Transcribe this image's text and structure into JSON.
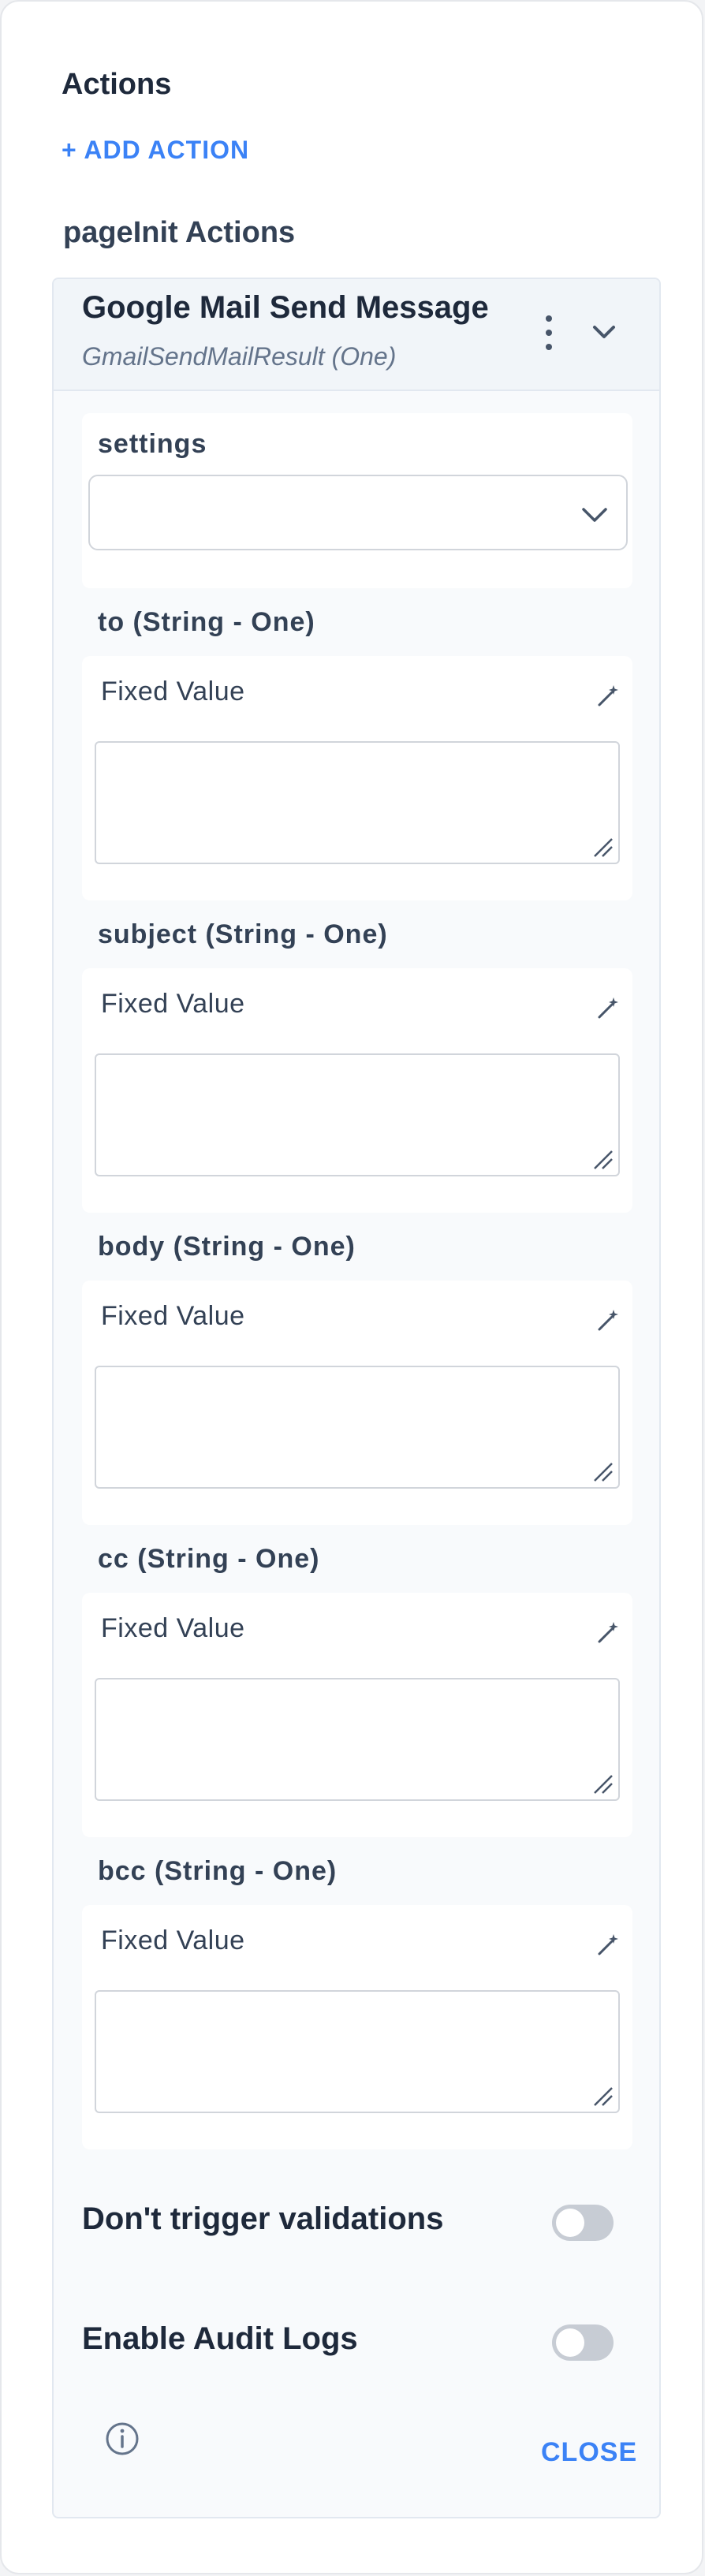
{
  "actions": {
    "title": "Actions",
    "add_action_label": "+ ADD ACTION",
    "page_init_title": "pageInit Actions"
  },
  "card": {
    "title": "Google Mail Send Message",
    "subtitle": "GmailSendMailResult (One)",
    "settings": {
      "label": "settings",
      "selected_value": ""
    },
    "fields": [
      {
        "label": "to (String - One)",
        "mode": "Fixed Value",
        "value": ""
      },
      {
        "label": "subject (String - One)",
        "mode": "Fixed Value",
        "value": ""
      },
      {
        "label": "body (String - One)",
        "mode": "Fixed Value",
        "value": ""
      },
      {
        "label": "cc (String - One)",
        "mode": "Fixed Value",
        "value": ""
      },
      {
        "label": "bcc (String - One)",
        "mode": "Fixed Value",
        "value": ""
      }
    ],
    "toggles": [
      {
        "label": "Don't trigger validations",
        "on": false
      },
      {
        "label": "Enable Audit Logs",
        "on": false
      }
    ],
    "close_label": "CLOSE"
  },
  "colors": {
    "accent": "#3b82f6",
    "text": "#1e293b",
    "toggle_off": "#c7ccd4"
  },
  "icons": [
    "more-vertical-icon",
    "chevron-down-icon",
    "magic-wand-icon",
    "resize-handle-icon",
    "info-icon"
  ]
}
